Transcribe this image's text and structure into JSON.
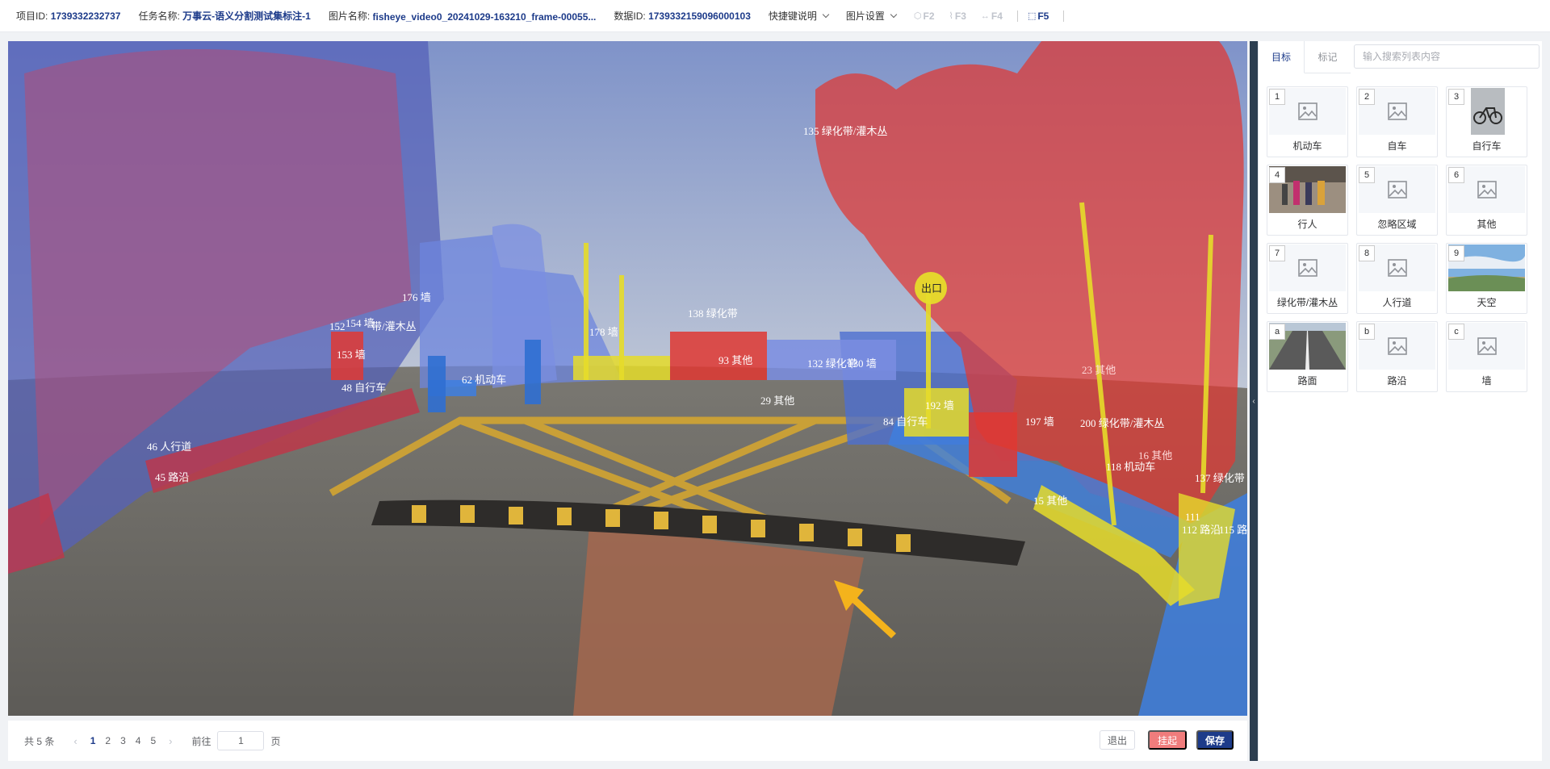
{
  "header": {
    "project": {
      "label": "项目ID:",
      "value": "1739332232737"
    },
    "task": {
      "label": "任务名称:",
      "value": "万事云-语义分割测试集标注-1"
    },
    "image": {
      "label": "图片名称:",
      "value": "fisheye_video0_20241029-163210_frame-00055..."
    },
    "data": {
      "label": "数据ID:",
      "value": "1739332159096000103"
    },
    "shortcut_menu": "快捷键说明",
    "image_settings_menu": "图片设置",
    "fkeys": [
      {
        "label": "F2",
        "active": false
      },
      {
        "label": "F3",
        "active": false
      },
      {
        "label": "F4",
        "active": false
      },
      {
        "label": "F5",
        "active": true
      }
    ]
  },
  "canvas": {
    "labels": [
      "135 绿化带/灌木丛",
      "176 墙",
      "152",
      "154 墙",
      "带/灌木丛",
      "153 墙",
      "48 自行车",
      "46 人行道",
      "45 路沿",
      "62 机动车",
      "138 绿化带",
      "178 墙",
      "93 其他",
      "29 其他",
      "132 绿化带",
      "130 墙",
      "84 自行车",
      "192 墙",
      "197 墙",
      "200 绿化带/灌木丛",
      "23 其他",
      "16 其他",
      "118 机动车",
      "137 绿化带",
      "15 其他",
      "112 路沿",
      "115 路",
      "111",
      "出口"
    ]
  },
  "pager": {
    "total": "共 5 条",
    "pages": [
      "1",
      "2",
      "3",
      "4",
      "5"
    ],
    "current": "1",
    "goto_label": "前往",
    "goto_value": "1",
    "page_unit": "页"
  },
  "actions": {
    "exit": "退出",
    "hang": "挂起",
    "save": "保存"
  },
  "panel": {
    "tabs": [
      "目标",
      "标记"
    ],
    "active_tab": "目标",
    "search_placeholder": "输入搜索列表内容",
    "cards": [
      {
        "index": "1",
        "label": "机动车",
        "thumb": "placeholder-image-icon"
      },
      {
        "index": "2",
        "label": "自车",
        "thumb": "placeholder-image-icon"
      },
      {
        "index": "3",
        "label": "自行车",
        "thumb": "bicycle-photo"
      },
      {
        "index": "4",
        "label": "行人",
        "thumb": "pedestrian-photo"
      },
      {
        "index": "5",
        "label": "忽略区域",
        "thumb": "placeholder-image-icon"
      },
      {
        "index": "6",
        "label": "其他",
        "thumb": "placeholder-image-icon"
      },
      {
        "index": "7",
        "label": "绿化带/灌木丛",
        "thumb": "placeholder-image-icon"
      },
      {
        "index": "8",
        "label": "人行道",
        "thumb": "placeholder-image-icon"
      },
      {
        "index": "9",
        "label": "天空",
        "thumb": "sky-photo"
      },
      {
        "index": "a",
        "label": "路面",
        "thumb": "road-photo"
      },
      {
        "index": "b",
        "label": "路沿",
        "thumb": "placeholder-image-icon"
      },
      {
        "index": "c",
        "label": "墙",
        "thumb": "placeholder-image-icon"
      }
    ]
  },
  "colors": {
    "primary": "#1d3b8a",
    "hang_button": "#f07c7c",
    "mask_red": "#e8302c",
    "mask_blue": "#3d7fe0",
    "mask_yellow": "#e6dc2a",
    "mask_purple": "#6a62c8"
  }
}
